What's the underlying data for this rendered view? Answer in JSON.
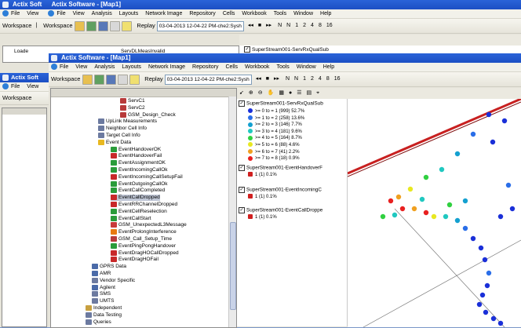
{
  "back_window": {
    "title": "Actix Software - [Map1]",
    "title_short": "Actix Soft",
    "menu": [
      "File",
      "View",
      "Analysis",
      "Layouts",
      "Network Image",
      "Repository",
      "Cells",
      "Workbook",
      "Tools",
      "Window",
      "Help"
    ],
    "workspace_label": "Workspace",
    "replay_label": "Replay",
    "datetime": "03-04-2013 12-04-22 PM-che2:Sysh",
    "speed_labels": [
      "N",
      "N",
      "1",
      "2",
      "4",
      "8",
      "16"
    ],
    "tree_loaded": "Loade",
    "tree_item": "ServDLMeasInvalid",
    "legend_title": "SuperStream001-ServRxQualSub"
  },
  "left_window": {
    "title": "Actix Soft",
    "menu_file": "File",
    "menu_view": "View",
    "workspace_label": "Workspace"
  },
  "front_window": {
    "title": "Actix Software - [Map1]",
    "menu": [
      "File",
      "View",
      "Analysis",
      "Layouts",
      "Network Image",
      "Repository",
      "Cells",
      "Workbook",
      "Tools",
      "Window",
      "Help"
    ],
    "workspace_label": "Workspace",
    "replay_label": "Replay",
    "datetime": "03-04-2013 12-04-22 PM-che2:Sysh",
    "speed_labels": [
      "N",
      "N",
      "1",
      "2",
      "4",
      "8",
      "16"
    ]
  },
  "tree": [
    {
      "label": "ServC1",
      "icon": "signal-icon",
      "color": "#b83a3a"
    },
    {
      "label": "ServC2",
      "icon": "signal-icon",
      "color": "#b83a3a"
    },
    {
      "label": "GSM_Design_Check",
      "icon": "signal-icon",
      "color": "#b83a3a"
    },
    {
      "label": "UpLink Measurements",
      "icon": "folder-icon",
      "color": "#6c7aa0"
    },
    {
      "label": "Neighbor Cell Info",
      "icon": "folder-icon",
      "color": "#6c7aa0"
    },
    {
      "label": "Target Cell Info",
      "icon": "folder-icon",
      "color": "#6c7aa0"
    },
    {
      "label": "Event Data",
      "icon": "star-icon",
      "color": "#e8b820"
    },
    {
      "label": "EventHandoverOK",
      "icon": "event-icon",
      "color": "#2a9c3a"
    },
    {
      "label": "EventHandoverFail",
      "icon": "event-icon",
      "color": "#c8282a"
    },
    {
      "label": "EventAssignmentOK",
      "icon": "event-icon",
      "color": "#2a9c3a"
    },
    {
      "label": "EventIncomingCallOk",
      "icon": "event-icon",
      "color": "#2a9c3a"
    },
    {
      "label": "EventIncomingCallSetupFail",
      "icon": "event-icon",
      "color": "#c8282a"
    },
    {
      "label": "EventOutgoingCallOk",
      "icon": "event-icon",
      "color": "#2a9c3a"
    },
    {
      "label": "EventCallCompleted",
      "icon": "event-icon",
      "color": "#2a9c3a"
    },
    {
      "label": "EventCallDropped",
      "icon": "event-icon",
      "color": "#c8282a"
    },
    {
      "label": "EventRRChannelDropped",
      "icon": "event-icon",
      "color": "#c8282a"
    },
    {
      "label": "EventCellReselection",
      "icon": "event-icon",
      "color": "#2a9c3a"
    },
    {
      "label": "EventCallStart",
      "icon": "event-icon",
      "color": "#2a9c3a"
    },
    {
      "label": "GSM_UnexpectedL3Message",
      "icon": "question-icon",
      "color": "#c83a3a"
    },
    {
      "label": "EventProlongInterference",
      "icon": "warning-icon",
      "color": "#e87a10"
    },
    {
      "label": "GSM_Call_Setup_Time",
      "icon": "signal-icon",
      "color": "#b83a3a"
    },
    {
      "label": "EventPingPongHandover",
      "icon": "event-icon",
      "color": "#2a9c3a"
    },
    {
      "label": "EventDragHOCallDropped",
      "icon": "event-icon",
      "color": "#c8282a"
    },
    {
      "label": "EventDragHOFail",
      "icon": "event-icon",
      "color": "#c8282a"
    },
    {
      "label": "GPRS Data",
      "icon": "gprs-icon",
      "color": "#4a6aa8"
    },
    {
      "label": "AMR",
      "icon": "amr-icon",
      "color": "#4a6aa8"
    },
    {
      "label": "Vendor Specific",
      "icon": "folder-icon",
      "color": "#6c7aa0"
    },
    {
      "label": "Agilent",
      "icon": "agilent-icon",
      "color": "#4a6aa8"
    },
    {
      "label": "SMS",
      "icon": "sms-icon",
      "color": "#6c7aa0"
    },
    {
      "label": "UMTS",
      "icon": "umts-icon",
      "color": "#6c7aa0"
    },
    {
      "label": "Independent",
      "icon": "folder-icon",
      "color": "#c8a040"
    },
    {
      "label": "Data Testing",
      "icon": "data-icon",
      "color": "#6c7aa0"
    },
    {
      "label": "Queries",
      "icon": "query-icon",
      "color": "#6c7aa0"
    }
  ],
  "legend": {
    "title": "SuperStream001-ServRxQualSub",
    "items": [
      {
        "label": ">= 0 to = 1 (999) 52.7%",
        "color": "#1a2fd8"
      },
      {
        "label": ">= 1 to = 2 (258) 13.6%",
        "color": "#2a6ee8"
      },
      {
        "label": ">= 2 to = 3 (146) 7.7%",
        "color": "#14a0d0"
      },
      {
        "label": ">= 3 to = 4 (181) 9.6%",
        "color": "#20c8c0"
      },
      {
        "label": ">= 4 to = 5 (164) 8.7%",
        "color": "#30d040"
      },
      {
        "label": ">= 5 to = 6 (88) 4.6%",
        "color": "#e8e820"
      },
      {
        "label": ">= 6 to = 7 (41) 2.2%",
        "color": "#f0a020"
      },
      {
        "label": ">= 7 to = 8 (18) 0.9%",
        "color": "#e82020"
      }
    ],
    "layers": [
      {
        "title": "SuperStream001-EventHandoverF",
        "count": "1 (1) 0.1%"
      },
      {
        "title": "SuperStream001-EventIncomingC",
        "count": "1 (1) 0.1%"
      },
      {
        "title": "SuperStream001-EventCallDroppe",
        "count": "1 (1) 0.1%"
      }
    ]
  },
  "colors": {
    "titlebar": "#2a63d8",
    "map_bg": "#ffffff",
    "route_line": "#c82020"
  }
}
